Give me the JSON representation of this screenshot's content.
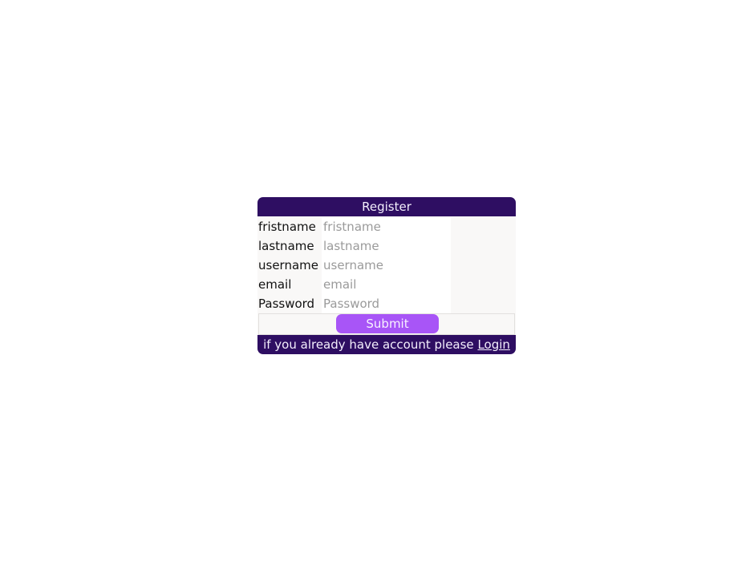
{
  "form": {
    "title": "Register",
    "fields": [
      {
        "label": "fristname",
        "placeholder": "fristname",
        "value": ""
      },
      {
        "label": "lastname",
        "placeholder": "lastname",
        "value": ""
      },
      {
        "label": "username",
        "placeholder": "username",
        "value": ""
      },
      {
        "label": "email",
        "placeholder": "email",
        "value": ""
      },
      {
        "label": "Password",
        "placeholder": "Password",
        "value": ""
      }
    ],
    "submit_label": "Submit"
  },
  "footer": {
    "text": "if you already have account please",
    "link_label": "Login"
  },
  "colors": {
    "header_bg": "#2e0e62",
    "button_bg": "#a855f7",
    "card_bg": "#f9f8f7"
  }
}
